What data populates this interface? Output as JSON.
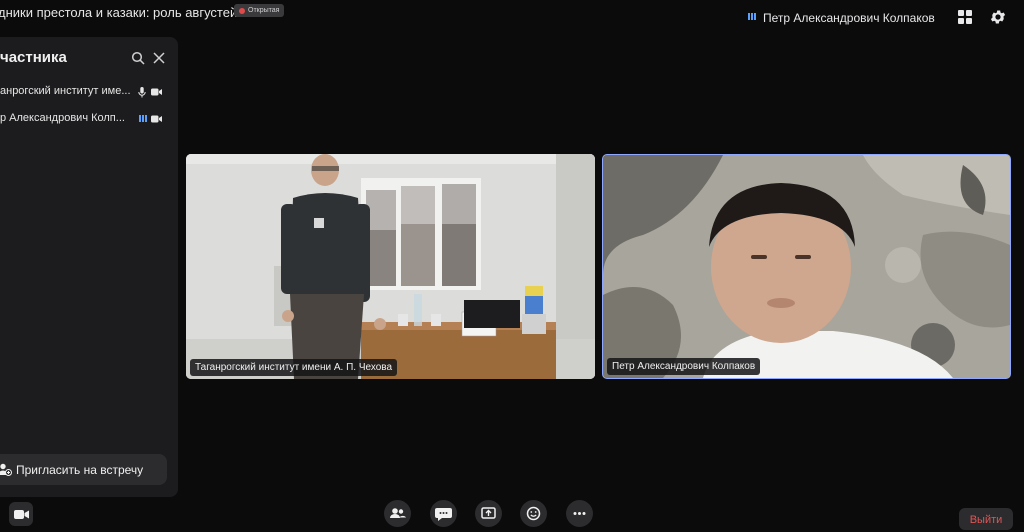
{
  "header": {
    "meeting_title": "дники престола и казаки: роль августей...",
    "access_badge": "Открытая",
    "user_name": "Петр Александрович Колпаков"
  },
  "participants_panel": {
    "title": "частника",
    "participants": [
      {
        "name": "анрогский институт име...",
        "mic_icon": "mic-icon",
        "camera_icon": "camera-icon"
      },
      {
        "name": "р Александрович Колп...",
        "mic_icon": "audio-level-icon",
        "camera_icon": "camera-icon"
      }
    ],
    "invite_label": "Пригласить на встречу"
  },
  "video_tiles": [
    {
      "label": "Таганрогский институт имени А. П. Чехова"
    },
    {
      "label": "Петр Александрович Колпаков"
    }
  ],
  "controls": {
    "exit_label": "Выйти",
    "buttons": [
      "participants-icon",
      "chat-icon",
      "screen-share-icon",
      "emoji-icon",
      "more-icon"
    ]
  },
  "colors": {
    "background": "#0b0b0c",
    "panel": "#1c1c1e",
    "button": "#2c2c2e",
    "accent": "#5aa0ff",
    "exit_text": "#e05555",
    "active_border": "#8ea7ff"
  }
}
